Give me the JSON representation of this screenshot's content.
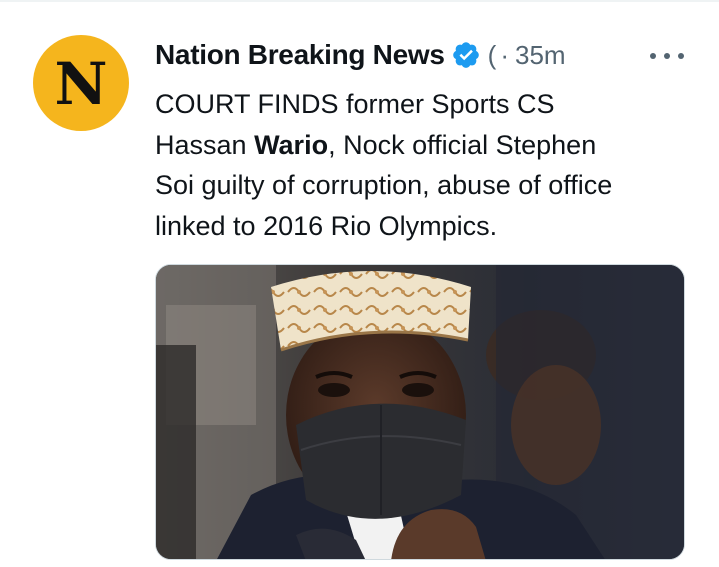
{
  "tweet": {
    "author": {
      "avatar_letter": "N",
      "avatar_color": "#F5B51D",
      "name": "Nation Breaking News",
      "verified": true,
      "badge_color": "#1D9BF0",
      "handle_truncated": "(",
      "separator": "·",
      "timestamp": "35m"
    },
    "more_icon": "more-horizontal-icon",
    "text": {
      "line1": "COURT FINDS former Sports CS",
      "line2_before": "Hassan ",
      "line2_bold": "Wario",
      "line2_after": ", Nock official Stephen",
      "line3": "Soi guilty of corruption, abuse of office",
      "line4": "linked to 2016 Rio Olympics."
    },
    "media": {
      "type": "photo"
    }
  }
}
